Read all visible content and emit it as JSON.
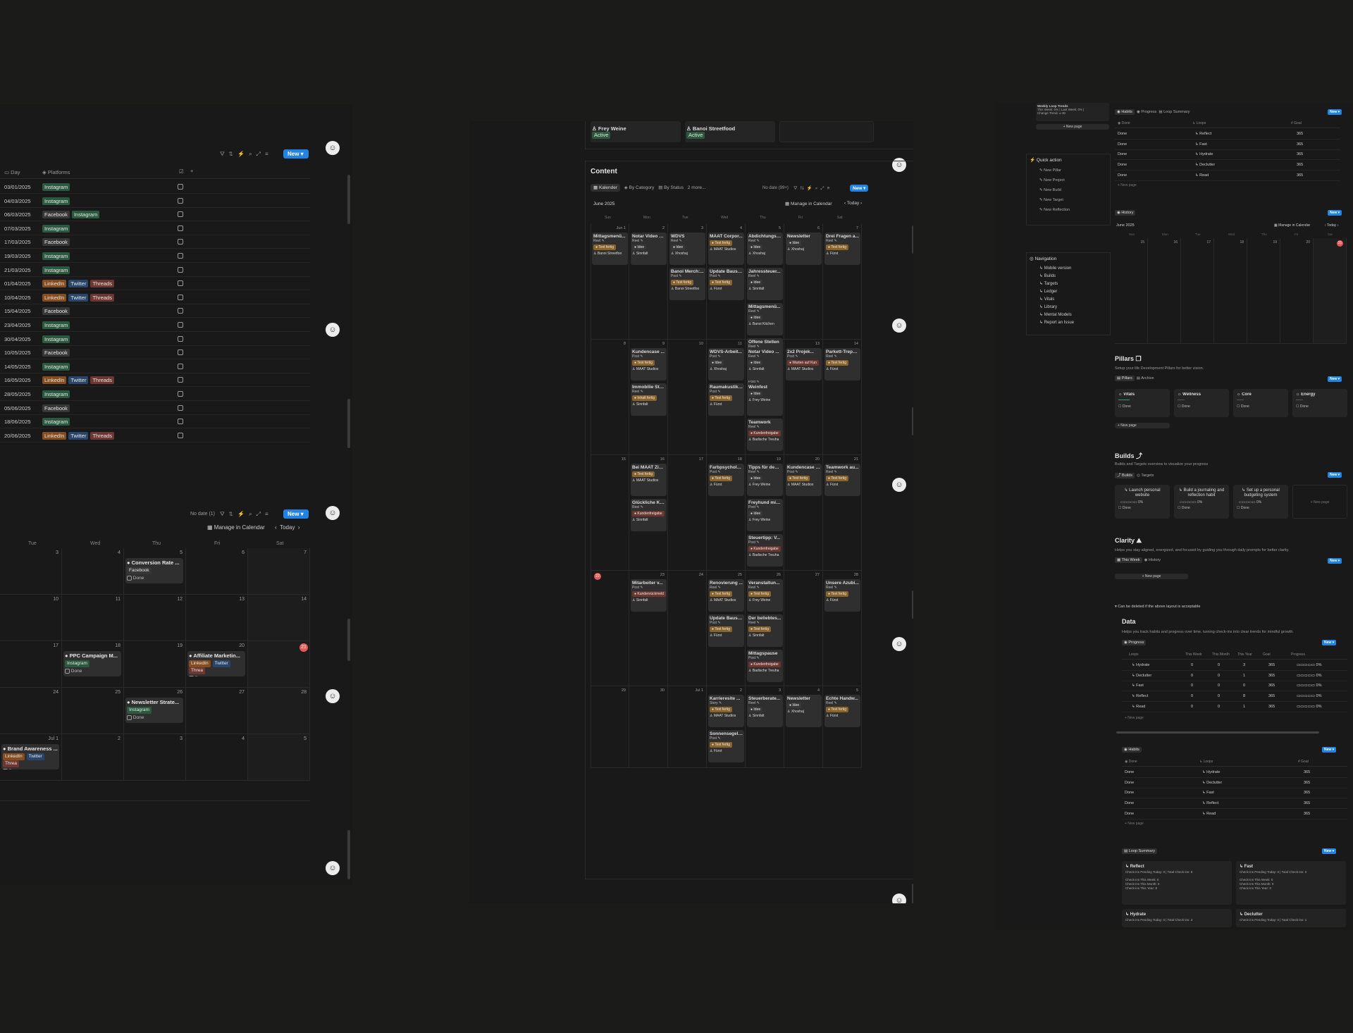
{
  "left": {
    "new_label": "New",
    "no_date": "No date (1)",
    "manage_calendar": "Manage in Calendar",
    "today": "Today",
    "table": {
      "col_day": "Day",
      "col_platforms": "Platforms",
      "rows": [
        {
          "day": "03/01/2025",
          "tags": [
            [
              "Instagram",
              "g"
            ]
          ]
        },
        {
          "day": "04/03/2025",
          "tags": [
            [
              "Instagram",
              "g"
            ]
          ]
        },
        {
          "day": "06/03/2025",
          "tags": [
            [
              "Facebook",
              "gr"
            ],
            [
              "Instagram",
              "g"
            ]
          ]
        },
        {
          "day": "07/03/2025",
          "tags": [
            [
              "Instagram",
              "g"
            ]
          ]
        },
        {
          "day": "17/03/2025",
          "tags": [
            [
              "Facebook",
              "gr"
            ]
          ]
        },
        {
          "day": "19/03/2025",
          "tags": [
            [
              "Instagram",
              "g"
            ]
          ]
        },
        {
          "day": "21/03/2025",
          "tags": [
            [
              "Instagram",
              "g"
            ]
          ]
        },
        {
          "day": "01/04/2025",
          "tags": [
            [
              "LinkedIn",
              "o"
            ],
            [
              "Twitter",
              "b"
            ],
            [
              "Threads",
              "r"
            ]
          ]
        },
        {
          "day": "10/04/2025",
          "tags": [
            [
              "LinkedIn",
              "o"
            ],
            [
              "Twitter",
              "b"
            ],
            [
              "Threads",
              "r"
            ]
          ]
        },
        {
          "day": "15/04/2025",
          "tags": [
            [
              "Facebook",
              "gr"
            ]
          ]
        },
        {
          "day": "23/04/2025",
          "tags": [
            [
              "Instagram",
              "g"
            ]
          ]
        },
        {
          "day": "30/04/2025",
          "tags": [
            [
              "Instagram",
              "g"
            ]
          ]
        },
        {
          "day": "10/05/2025",
          "tags": [
            [
              "Facebook",
              "gr"
            ]
          ]
        },
        {
          "day": "14/05/2025",
          "tags": [
            [
              "Instagram",
              "g"
            ]
          ]
        },
        {
          "day": "16/05/2025",
          "tags": [
            [
              "LinkedIn",
              "o"
            ],
            [
              "Twitter",
              "b"
            ],
            [
              "Threads",
              "r"
            ]
          ]
        },
        {
          "day": "28/05/2025",
          "tags": [
            [
              "Instagram",
              "g"
            ]
          ]
        },
        {
          "day": "05/06/2025",
          "tags": [
            [
              "Facebook",
              "gr"
            ]
          ]
        },
        {
          "day": "18/06/2025",
          "tags": [
            [
              "Instagram",
              "g"
            ]
          ]
        },
        {
          "day": "20/06/2025",
          "tags": [
            [
              "LinkedIn",
              "o"
            ],
            [
              "Twitter",
              "b"
            ],
            [
              "Threads",
              "r"
            ]
          ]
        }
      ]
    },
    "weekdays": [
      "Tue",
      "Wed",
      "Thu",
      "Fri",
      "Sat"
    ],
    "cal_rows": [
      [
        "3",
        "4",
        "5",
        "6",
        "7"
      ],
      [
        "10",
        "11",
        "12",
        "13",
        "14"
      ],
      [
        "17",
        "18",
        "19",
        "20",
        "21"
      ],
      [
        "24",
        "25",
        "26",
        "27",
        "28"
      ],
      [
        "Jul 1",
        "2",
        "3",
        "4",
        "5"
      ]
    ],
    "events": [
      {
        "title": "Conversion Rate ...",
        "tags": [
          [
            "Facebook",
            "gr"
          ]
        ],
        "done": "Done",
        "col": 2,
        "row": 0
      },
      {
        "title": "PPC Campaign M...",
        "tags": [
          [
            "Instagram",
            "g"
          ]
        ],
        "done": "Done",
        "col": 1,
        "row": 2
      },
      {
        "title": "Affiliate Marketin...",
        "tags": [
          [
            "LinkedIn",
            "o"
          ],
          [
            "Twitter",
            "b"
          ],
          [
            "Threa",
            "r"
          ]
        ],
        "done": "Done",
        "col": 3,
        "row": 2
      },
      {
        "title": "Newsletter Strate...",
        "tags": [
          [
            "Instagram",
            "g"
          ]
        ],
        "done": "Done",
        "col": 2,
        "row": 3
      },
      {
        "title": "Brand Awareness ...",
        "tags": [
          [
            "LinkedIn",
            "o"
          ],
          [
            "Twitter",
            "b"
          ],
          [
            "Threa",
            "r"
          ]
        ],
        "done": "Done",
        "col": 0,
        "row": 4
      }
    ]
  },
  "middle": {
    "top_cards": [
      {
        "name": "Frey Weine",
        "status": "Active"
      },
      {
        "name": "Banoi Streetfood",
        "status": "Active"
      }
    ],
    "section_title": "Content",
    "tabs": [
      "Kalender",
      "By Category",
      "By Status",
      "2 more..."
    ],
    "no_date": "No date (99+)",
    "new_label": "New",
    "month": "June 2025",
    "manage_calendar": "Manage in Calendar",
    "today": "Today",
    "weekdays": [
      "Sun",
      "Mon",
      "Tue",
      "Wed",
      "Thu",
      "Fri",
      "Sat"
    ],
    "weeks": [
      [
        "Jun 1",
        "2",
        "3",
        "4",
        "5",
        "6",
        "7"
      ],
      [
        "8",
        "9",
        "10",
        "11",
        "12",
        "13",
        "14"
      ],
      [
        "15",
        "16",
        "17",
        "18",
        "19",
        "20",
        "21"
      ],
      [
        "22",
        "23",
        "24",
        "25",
        "26",
        "27",
        "28"
      ],
      [
        "29",
        "30",
        "Jul 1",
        "2",
        "3",
        "4",
        "5"
      ]
    ],
    "today_day": "22",
    "cards": [
      {
        "w": 0,
        "d": 0,
        "i": 0,
        "title": "Mittagsmenü...",
        "t": "Reel",
        "s": "Text fertig",
        "sc": "y",
        "who": "Banoi Streetfoo"
      },
      {
        "w": 0,
        "d": 1,
        "i": 0,
        "title": "Notar Video 1...",
        "t": "Reel",
        "s": "Idee",
        "sc": "gr",
        "who": "Sinnfalt"
      },
      {
        "w": 0,
        "d": 2,
        "i": 0,
        "title": "WDVS",
        "t": "Reel",
        "s": "Idee",
        "sc": "gr",
        "who": "Xhoshaj"
      },
      {
        "w": 0,
        "d": 2,
        "i": 1,
        "title": "Banoi Merch:...",
        "t": "Post",
        "s": "Text fertig",
        "sc": "y",
        "who": "Banoi Streetfoo"
      },
      {
        "w": 0,
        "d": 3,
        "i": 0,
        "title": "MAAT Corpor...",
        "t": "",
        "s": "Text fertig",
        "sc": "y",
        "who": "MAAT Studios"
      },
      {
        "w": 0,
        "d": 3,
        "i": 1,
        "title": "Update Baust...",
        "t": "Post",
        "s": "Text fertig",
        "sc": "y",
        "who": "Fürst"
      },
      {
        "w": 0,
        "d": 4,
        "i": 0,
        "title": "Abdichtungss...",
        "t": "Reel",
        "s": "Idee",
        "sc": "gr",
        "who": "Xhoshaj"
      },
      {
        "w": 0,
        "d": 4,
        "i": 1,
        "title": "Jahressteuer...",
        "t": "Reel",
        "s": "Idee",
        "sc": "gr",
        "who": "Sinnfalt"
      },
      {
        "w": 0,
        "d": 4,
        "i": 2,
        "title": "Mittagsmenü...",
        "t": "Reel",
        "s": "Idee",
        "sc": "gr",
        "who": "Banoi Kitchen"
      },
      {
        "w": 0,
        "d": 4,
        "i": 3,
        "title": "Offene Stellen",
        "t": "Reel",
        "s": "Kundenfreigabe",
        "sc": "r",
        "who": "Badische Treuha"
      },
      {
        "w": 0,
        "d": 4,
        "i": 4,
        "title": "Kooperation ...",
        "t": "Post",
        "s": "Text fertig",
        "sc": "y",
        "who": "Frey Weine"
      },
      {
        "w": 0,
        "d": 5,
        "i": 0,
        "title": "Newsletter",
        "t": "",
        "s": "Idee",
        "sc": "gr",
        "who": "Xhoshaj"
      },
      {
        "w": 0,
        "d": 6,
        "i": 0,
        "title": "Drei Fragen a...",
        "t": "Reel",
        "s": "Text fertig",
        "sc": "y",
        "who": "Fürst"
      },
      {
        "w": 1,
        "d": 1,
        "i": 0,
        "title": "Kundencase ...",
        "t": "Post",
        "s": "Text fertig",
        "sc": "y",
        "who": "MAAT Studios"
      },
      {
        "w": 1,
        "d": 1,
        "i": 1,
        "title": "Immobilie Sta...",
        "t": "Reel",
        "s": "Inhalt fertig",
        "sc": "y",
        "who": "Sinnfalt"
      },
      {
        "w": 1,
        "d": 3,
        "i": 0,
        "title": "WDVS-Arbeit...",
        "t": "Post",
        "s": "Idee",
        "sc": "gr",
        "who": "Xhoshaj"
      },
      {
        "w": 1,
        "d": 3,
        "i": 1,
        "title": "Raumakustik:...",
        "t": "Post",
        "s": "Text fertig",
        "sc": "y",
        "who": "Fürst"
      },
      {
        "w": 1,
        "d": 4,
        "i": 0,
        "title": "Notar Video ...",
        "t": "Reel",
        "s": "Idee",
        "sc": "gr",
        "who": "Sinnfalt"
      },
      {
        "w": 1,
        "d": 4,
        "i": 1,
        "title": "Weinfest",
        "t": "",
        "s": "Idee",
        "sc": "gr",
        "who": "Frey Weine"
      },
      {
        "w": 1,
        "d": 4,
        "i": 2,
        "title": "Teamwork",
        "t": "Reel",
        "s": "Kundenfreigabe",
        "sc": "r",
        "who": "Badische Treuha"
      },
      {
        "w": 1,
        "d": 5,
        "i": 0,
        "title": "2x2 Projek...",
        "t": "Post",
        "s": "Warten auf Kun",
        "sc": "r",
        "who": "MAAT Studios"
      },
      {
        "w": 1,
        "d": 6,
        "i": 0,
        "title": "Parkett-Trepp...",
        "t": "Reel",
        "s": "Text fertig",
        "sc": "y",
        "who": "Fürst"
      },
      {
        "w": 2,
        "d": 1,
        "i": 0,
        "title": "Bei MAAT Ziel...",
        "t": "",
        "s": "Text fertig",
        "sc": "y",
        "who": "MAAT Studios"
      },
      {
        "w": 2,
        "d": 1,
        "i": 1,
        "title": "Glückliche Ku...",
        "t": "Reel",
        "s": "Kundenfreigabe",
        "sc": "r",
        "who": "Sinnfalt"
      },
      {
        "w": 2,
        "d": 3,
        "i": 0,
        "title": "Farbpsycholo...",
        "t": "Post",
        "s": "Text fertig",
        "sc": "y",
        "who": "Fürst"
      },
      {
        "w": 2,
        "d": 4,
        "i": 0,
        "title": "Tipps für den ...",
        "t": "Reel",
        "s": "Idee",
        "sc": "gr",
        "who": "Frey Weine"
      },
      {
        "w": 2,
        "d": 4,
        "i": 1,
        "title": "Freyhund mit ...",
        "t": "Post",
        "s": "Idee",
        "sc": "gr",
        "who": "Frey Weine"
      },
      {
        "w": 2,
        "d": 4,
        "i": 2,
        "title": "Steuertipp: V...",
        "t": "Post",
        "s": "Kundenfreigabe",
        "sc": "r",
        "who": "Badische Treuha"
      },
      {
        "w": 2,
        "d": 5,
        "i": 0,
        "title": "Kundencase F...",
        "t": "Post",
        "s": "Text fertig",
        "sc": "y",
        "who": "MAAT Studios"
      },
      {
        "w": 2,
        "d": 6,
        "i": 0,
        "title": "Teamwork au...",
        "t": "Reel",
        "s": "Text fertig",
        "sc": "y",
        "who": "Fürst"
      },
      {
        "w": 3,
        "d": 1,
        "i": 0,
        "title": "Mitarbeiter v...",
        "t": "Post",
        "s": "Kundenrückmeld",
        "sc": "r",
        "who": "Sinnfalt"
      },
      {
        "w": 3,
        "d": 3,
        "i": 0,
        "title": "Renovierung ...",
        "t": "Reel",
        "s": "Text fertig",
        "sc": "y",
        "who": "MAAT Studios"
      },
      {
        "w": 3,
        "d": 3,
        "i": 1,
        "title": "Update Baust...",
        "t": "Post",
        "s": "Text fertig",
        "sc": "y",
        "who": "Fürst"
      },
      {
        "w": 3,
        "d": 4,
        "i": 0,
        "title": "Veranstaltun...",
        "t": "Reel",
        "s": "Text fertig",
        "sc": "y",
        "who": "Frey Weine"
      },
      {
        "w": 3,
        "d": 4,
        "i": 1,
        "title": "Der beliebtes...",
        "t": "Reel",
        "s": "Text fertig",
        "sc": "y",
        "who": "Sinnfalt"
      },
      {
        "w": 3,
        "d": 4,
        "i": 2,
        "title": "Mittagspause",
        "t": "Post",
        "s": "Kundenfreigabe",
        "sc": "r",
        "who": "Badische Treuha"
      },
      {
        "w": 3,
        "d": 6,
        "i": 0,
        "title": "Unsere Azubi...",
        "t": "Reel",
        "s": "Text fertig",
        "sc": "y",
        "who": "Fürst"
      },
      {
        "w": 4,
        "d": 3,
        "i": 0,
        "title": "Karrieresite ...",
        "t": "Story",
        "s": "Text fertig",
        "sc": "y",
        "who": "MAAT Studios"
      },
      {
        "w": 4,
        "d": 3,
        "i": 1,
        "title": "Sonnensegel: ...",
        "t": "Post",
        "s": "Text fertig",
        "sc": "y",
        "who": "Fürst"
      },
      {
        "w": 4,
        "d": 4,
        "i": 0,
        "title": "Steuerberate...",
        "t": "Reel",
        "s": "Idee",
        "sc": "gr",
        "who": "Sinnfalt"
      },
      {
        "w": 4,
        "d": 5,
        "i": 0,
        "title": "Newsletter",
        "t": "",
        "s": "Idee",
        "sc": "gr",
        "who": "Xhoshaj"
      },
      {
        "w": 4,
        "d": 6,
        "i": 0,
        "title": "Echte Handw...",
        "t": "Reel",
        "s": "Text fertig",
        "sc": "y",
        "who": "Fürst"
      }
    ]
  },
  "right": {
    "weekly": [
      "Weekly Loop Trends",
      "This Week: 0% | Last Week: 0% |",
      "Change Trend: ±-30"
    ],
    "new_page": "+ New page",
    "quick_action": {
      "title": "Quick action",
      "items": [
        "New Pillar",
        "New Project",
        "New Build",
        "New Target",
        "New Reflection"
      ]
    },
    "navigation": {
      "title": "Navigation",
      "items": [
        "Mobile version",
        "Builds",
        "Targets",
        "Ledger",
        "Vitals",
        "Library",
        "Mental Models",
        "Report an Issue"
      ]
    },
    "habits_tabs": [
      "Habits",
      "Progress",
      "Loop Summary"
    ],
    "habits_cols": [
      "Done",
      "Loops",
      "Goal"
    ],
    "habits1": [
      [
        "Done",
        "Reflect",
        "365"
      ],
      [
        "Done",
        "Fast",
        "365"
      ],
      [
        "Done",
        "Hydrate",
        "365"
      ],
      [
        "Done",
        "Declutter",
        "365"
      ],
      [
        "Done",
        "Read",
        "365"
      ]
    ],
    "history": {
      "tab": "History",
      "month": "June 2025",
      "manage": "Manage in Calendar",
      "today": "Today",
      "weekdays": [
        "Sun",
        "Mon",
        "Tue",
        "Wed",
        "Thu",
        "Fri",
        "Sat"
      ],
      "days": [
        "15",
        "16",
        "17",
        "18",
        "19",
        "20",
        "21"
      ]
    },
    "pillars": {
      "title": "Pillars",
      "desc": "Setup your life Development Pillars for better vision.",
      "tabs": [
        "Pillars",
        "Archive"
      ],
      "cards": [
        "Vitals",
        "Wellness",
        "Core",
        "Energy"
      ],
      "done": "Done"
    },
    "builds": {
      "title": "Builds",
      "desc": "Builds and Targets overview to visualize your progress",
      "tabs": [
        "Builds",
        "Targets"
      ],
      "cards": [
        "Launch personal website",
        "Build a journaling and reflection habit",
        "Set up a personal budgeting system"
      ],
      "pct": "0%",
      "done": "Done",
      "new_page": "+ New page"
    },
    "clarity": {
      "title": "Clarity",
      "desc": "Helps you stay aligned, energized, and focused by guiding you through daily prompts for better clarity.",
      "tabs": [
        "This Week",
        "History"
      ],
      "new_page": "+ New page"
    },
    "toggle": "Can be deleted if the above layout is acceptable",
    "data": {
      "title": "Data",
      "desc": "Helps you track habits and progress over time, turning check-ins into clear trends for mindful growth.",
      "tab": "Progress",
      "cols": [
        "Loops",
        "This Week",
        "This Month",
        "This Year",
        "Goal",
        "Progress"
      ],
      "rows": [
        [
          "Hydrate",
          "0",
          "0",
          "3",
          "365",
          "0%"
        ],
        [
          "Declutter",
          "0",
          "0",
          "1",
          "365",
          "0%"
        ],
        [
          "Fast",
          "0",
          "0",
          "0",
          "365",
          "0%"
        ],
        [
          "Reflect",
          "0",
          "0",
          "8",
          "365",
          "0%"
        ],
        [
          "Read",
          "0",
          "0",
          "1",
          "365",
          "0%"
        ]
      ]
    },
    "habits2": [
      [
        "Done",
        "Hydrate",
        "365"
      ],
      [
        "Done",
        "Declutter",
        "365"
      ],
      [
        "Done",
        "Fast",
        "365"
      ],
      [
        "Done",
        "Reflect",
        "365"
      ],
      [
        "Done",
        "Read",
        "365"
      ]
    ],
    "loop_summary": {
      "tab": "Loop Summary",
      "cards": [
        "Reflect",
        "Fast",
        "Hydrate",
        "Declutter"
      ],
      "line1": "Check-ins Pending Today: 0 | Total Check-ins: 8",
      "line1b": "Check-ins Pending Today: 0 | Total Check-ins: 0",
      "line1c": "Check-ins Pending Today: 0 | Total Check-ins: 3",
      "line1d": "Check-ins Pending Today: 0 | Total Check-ins: 1",
      "week": "Check-ins This Week: 0",
      "month": "Check-ins This Month: 0",
      "year": "Check-ins This Year: 8",
      "yearb": "Check-ins This Year: 0"
    },
    "new_label": "New"
  }
}
